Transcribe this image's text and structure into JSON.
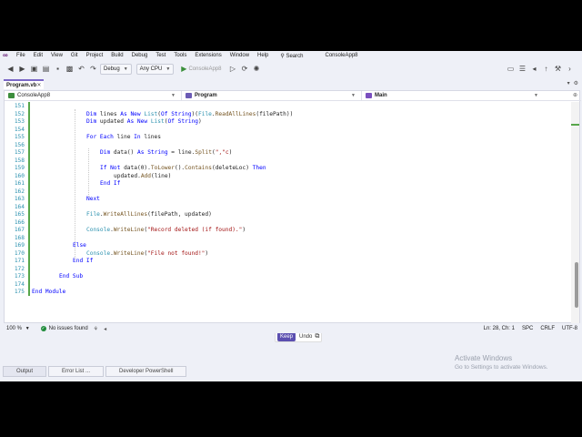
{
  "menubar": {
    "items": [
      "File",
      "Edit",
      "View",
      "Git",
      "Project",
      "Build",
      "Debug",
      "Test",
      "Tools",
      "Extensions",
      "Window",
      "Help"
    ],
    "search_label": "Search",
    "solution_name": "ConsoleApp8"
  },
  "toolbar": {
    "config": "Debug",
    "platform": "Any CPU",
    "run_target": "ConsoleApp8"
  },
  "tabs": {
    "active_file": "Program.vb",
    "close_glyph": "✕"
  },
  "navbar": {
    "project": "ConsoleApp8",
    "module": "Program",
    "member": "Main"
  },
  "code": {
    "lines": [
      {
        "n": "151",
        "indent": 0,
        "tokens": []
      },
      {
        "n": "152",
        "indent": 16,
        "tokens": [
          [
            "kw",
            "Dim"
          ],
          [
            "t",
            " lines "
          ],
          [
            "kw",
            "As New"
          ],
          [
            "t",
            " "
          ],
          [
            "ty",
            "List"
          ],
          [
            "t",
            "("
          ],
          [
            "kw",
            "Of"
          ],
          [
            "t",
            " "
          ],
          [
            "kw",
            "String"
          ],
          [
            "t",
            ")("
          ],
          [
            "ty",
            "File"
          ],
          [
            "t",
            "."
          ],
          [
            "fn",
            "ReadAllLines"
          ],
          [
            "t",
            "(filePath))"
          ]
        ]
      },
      {
        "n": "153",
        "indent": 16,
        "tokens": [
          [
            "kw",
            "Dim"
          ],
          [
            "t",
            " updated "
          ],
          [
            "kw",
            "As New"
          ],
          [
            "t",
            " "
          ],
          [
            "ty",
            "List"
          ],
          [
            "t",
            "("
          ],
          [
            "kw",
            "Of"
          ],
          [
            "t",
            " "
          ],
          [
            "kw",
            "String"
          ],
          [
            "t",
            ")"
          ]
        ]
      },
      {
        "n": "154",
        "indent": 0,
        "tokens": []
      },
      {
        "n": "155",
        "indent": 16,
        "tokens": [
          [
            "kw",
            "For Each"
          ],
          [
            "t",
            " line "
          ],
          [
            "kw",
            "In"
          ],
          [
            "t",
            " lines"
          ]
        ]
      },
      {
        "n": "156",
        "indent": 0,
        "tokens": []
      },
      {
        "n": "157",
        "indent": 20,
        "tokens": [
          [
            "kw",
            "Dim"
          ],
          [
            "t",
            " data() "
          ],
          [
            "kw",
            "As"
          ],
          [
            "t",
            " "
          ],
          [
            "kw",
            "String"
          ],
          [
            "t",
            " = line."
          ],
          [
            "fn",
            "Split"
          ],
          [
            "t",
            "("
          ],
          [
            "str",
            "\",\"c"
          ],
          [
            "t",
            ")"
          ]
        ]
      },
      {
        "n": "158",
        "indent": 0,
        "tokens": []
      },
      {
        "n": "159",
        "indent": 20,
        "tokens": [
          [
            "kw",
            "If Not"
          ],
          [
            "t",
            " data(0)."
          ],
          [
            "fn",
            "ToLower"
          ],
          [
            "t",
            "()."
          ],
          [
            "fn",
            "Contains"
          ],
          [
            "t",
            "(deleteLoc) "
          ],
          [
            "kw",
            "Then"
          ]
        ]
      },
      {
        "n": "160",
        "indent": 24,
        "tokens": [
          [
            "t",
            "updated."
          ],
          [
            "fn",
            "Add"
          ],
          [
            "t",
            "(line)"
          ]
        ]
      },
      {
        "n": "161",
        "indent": 20,
        "tokens": [
          [
            "kw",
            "End If"
          ]
        ]
      },
      {
        "n": "162",
        "indent": 0,
        "tokens": []
      },
      {
        "n": "163",
        "indent": 16,
        "tokens": [
          [
            "kw",
            "Next"
          ]
        ]
      },
      {
        "n": "164",
        "indent": 0,
        "tokens": []
      },
      {
        "n": "165",
        "indent": 16,
        "tokens": [
          [
            "ty",
            "File"
          ],
          [
            "t",
            "."
          ],
          [
            "fn",
            "WriteAllLines"
          ],
          [
            "t",
            "(filePath, updated)"
          ]
        ]
      },
      {
        "n": "166",
        "indent": 0,
        "tokens": []
      },
      {
        "n": "167",
        "indent": 16,
        "tokens": [
          [
            "ty",
            "Console"
          ],
          [
            "t",
            "."
          ],
          [
            "fn",
            "WriteLine"
          ],
          [
            "t",
            "("
          ],
          [
            "str",
            "\"Record deleted (if found).\""
          ],
          [
            "t",
            ")"
          ]
        ]
      },
      {
        "n": "168",
        "indent": 0,
        "tokens": []
      },
      {
        "n": "169",
        "indent": 12,
        "tokens": [
          [
            "kw",
            "Else"
          ]
        ]
      },
      {
        "n": "170",
        "indent": 16,
        "tokens": [
          [
            "ty",
            "Console"
          ],
          [
            "t",
            "."
          ],
          [
            "fn",
            "WriteLine"
          ],
          [
            "t",
            "("
          ],
          [
            "str",
            "\"File not found!\""
          ],
          [
            "t",
            ")"
          ]
        ]
      },
      {
        "n": "171",
        "indent": 12,
        "tokens": [
          [
            "kw",
            "End If"
          ]
        ]
      },
      {
        "n": "172",
        "indent": 0,
        "tokens": []
      },
      {
        "n": "173",
        "indent": 8,
        "tokens": [
          [
            "kw",
            "End Sub"
          ]
        ]
      },
      {
        "n": "174",
        "indent": 0,
        "tokens": []
      },
      {
        "n": "175",
        "indent": 0,
        "tokens": [
          [
            "kw",
            "End Module"
          ]
        ]
      }
    ]
  },
  "popup": {
    "keep_label": "Keep",
    "undo_label": "Undo"
  },
  "status": {
    "zoom": "100 %",
    "issues": "No issues found",
    "position": "Ln: 28, Ch: 1",
    "whitespace": "SPC",
    "line_ending": "CRLF",
    "encoding": "UTF-8"
  },
  "bottom_tabs": [
    "Output",
    "Error List ...",
    "Developer PowerShell"
  ],
  "watermark": {
    "title": "Activate Windows",
    "subtitle": "Go to Settings to activate Windows."
  },
  "colors": {
    "keyword": "#0000ff",
    "type": "#2b91af",
    "string": "#a31515",
    "accent": "#5b4fb0"
  }
}
